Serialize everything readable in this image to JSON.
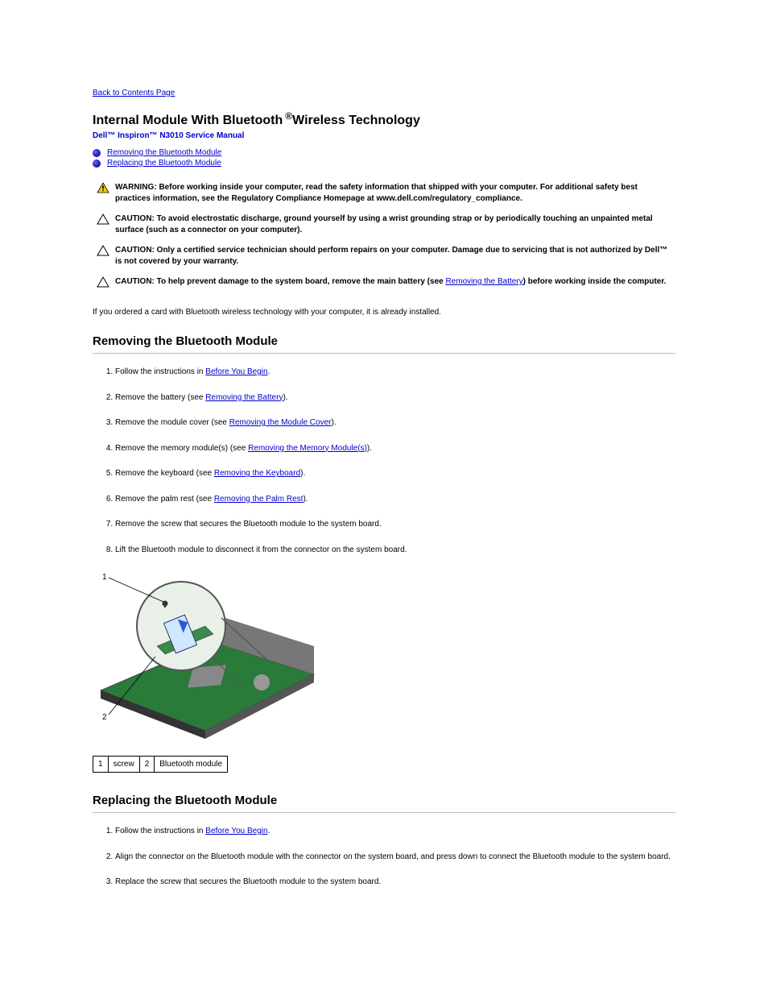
{
  "back_link": "Back to Contents Page",
  "title_main": "Internal Module With Bluetooth",
  "title_trail": " Wireless Technology",
  "subtitle": "Dell™ Inspiron™ N3010 Service Manual",
  "toc": [
    {
      "label": "Removing the Bluetooth Module"
    },
    {
      "label": "Replacing the Bluetooth Module"
    }
  ],
  "notices": [
    {
      "type": "warning",
      "lead": "WARNING: ",
      "body": "Before working inside your computer, read the safety information that shipped with your computer. For additional safety best practices information, see the Regulatory Compliance Homepage at www.dell.com/regulatory_compliance."
    },
    {
      "type": "caution",
      "lead": "CAUTION: ",
      "body": "To avoid electrostatic discharge, ground yourself by using a wrist grounding strap or by periodically touching an unpainted metal surface (such as a connector on your computer)."
    },
    {
      "type": "caution",
      "lead": "CAUTION: ",
      "body_prefix": "",
      "body": "Only a certified service technician should perform repairs on your computer. Damage due to servicing that is not authorized by Dell™ is not covered by your warranty."
    },
    {
      "type": "caution",
      "lead": "CAUTION: ",
      "body_before_link": "To help prevent damage to the system board, remove the main battery (see ",
      "link": "Removing the Battery",
      "body_after_link": ") before working inside the computer."
    }
  ],
  "intro_para": "If you ordered a card with Bluetooth wireless technology with your computer, it is already installed.",
  "section_remove": "Removing the Bluetooth Module",
  "remove_steps": [
    {
      "text_before": "Follow the instructions in ",
      "link": "Before You Begin",
      "text_after": "."
    },
    {
      "text_before": "Remove the battery (see ",
      "link": "Removing the Battery",
      "text_after": ")."
    },
    {
      "text_before": "Remove the module cover (see ",
      "link": "Removing the Module Cover",
      "text_after": ")."
    },
    {
      "text_before": "Remove the memory module(s) (see ",
      "link": "Removing the Memory Module(s)",
      "text_after": ")."
    },
    {
      "text_before": "Remove the keyboard (see ",
      "link": "Removing the Keyboard",
      "text_after": ")."
    },
    {
      "text_before": "Remove the palm rest (see ",
      "link": "Removing the Palm Rest",
      "text_after": ")."
    },
    {
      "text_before": "Remove the screw that secures the Bluetooth module to the system board.",
      "link": null,
      "text_after": ""
    },
    {
      "text_before": "Lift the Bluetooth module to disconnect it from the connector on the system board.",
      "link": null,
      "text_after": ""
    }
  ],
  "callouts": [
    {
      "num": "1",
      "label": "screw"
    },
    {
      "num": "2",
      "label": "Bluetooth module"
    }
  ],
  "section_replace": "Replacing the Bluetooth Module",
  "replace_steps": [
    {
      "text_before": "Follow the instructions in ",
      "link": "Before You Begin",
      "text_after": "."
    },
    {
      "text_before": "Align the connector on the Bluetooth module with the connector on the system board, and press down to connect the Bluetooth module to the system board.",
      "link": null,
      "text_after": ""
    },
    {
      "text_before": "Replace the screw that secures the Bluetooth module to the system board.",
      "link": null,
      "text_after": ""
    }
  ]
}
